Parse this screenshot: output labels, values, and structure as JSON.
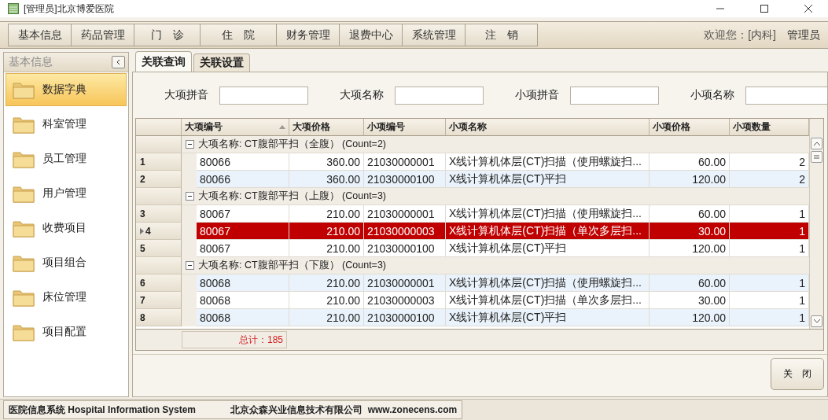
{
  "window": {
    "title": "[管理员]北京博爱医院"
  },
  "menu": [
    "基本信息",
    "药品管理",
    "门　诊",
    "住　院",
    "财务管理",
    "退费中心",
    "系统管理",
    "注　销"
  ],
  "user": {
    "welcome": "欢迎您：[内科]",
    "name": "管理员"
  },
  "sidebar": {
    "title": "基本信息",
    "items": [
      {
        "label": "数据字典",
        "selected": true
      },
      {
        "label": "科室管理",
        "selected": false
      },
      {
        "label": "员工管理",
        "selected": false
      },
      {
        "label": "用户管理",
        "selected": false
      },
      {
        "label": "收费项目",
        "selected": false
      },
      {
        "label": "项目组合",
        "selected": false
      },
      {
        "label": "床位管理",
        "selected": false
      },
      {
        "label": "项目配置",
        "selected": false
      }
    ]
  },
  "tabs": [
    {
      "label": "关联查询",
      "selected": true
    },
    {
      "label": "关联设置",
      "selected": false
    }
  ],
  "filters": [
    {
      "label": "大项拼音"
    },
    {
      "label": "大项名称"
    },
    {
      "label": "小项拼音"
    },
    {
      "label": "小项名称"
    }
  ],
  "table": {
    "columns": [
      "大项编号",
      "大项价格",
      "小项编号",
      "小项名称",
      "小项价格",
      "小项数量"
    ],
    "rows": [
      {
        "kind": "group",
        "label": "大项名称: CT腹部平扫（全腹） (Count=2)",
        "expanded": true
      },
      {
        "kind": "item",
        "number": "1",
        "selected": false,
        "cells": [
          "80066",
          "360.00",
          "21030000001",
          "X线计算机体层(CT)扫描（使用螺旋扫...",
          "60.00",
          "2"
        ]
      },
      {
        "kind": "item",
        "number": "2",
        "selected": false,
        "cells": [
          "80066",
          "360.00",
          "21030000100",
          "X线计算机体层(CT)平扫",
          "120.00",
          "2"
        ]
      },
      {
        "kind": "group",
        "label": "大项名称: CT腹部平扫（上腹） (Count=3)",
        "expanded": true
      },
      {
        "kind": "item",
        "number": "3",
        "selected": false,
        "cells": [
          "80067",
          "210.00",
          "21030000001",
          "X线计算机体层(CT)扫描（使用螺旋扫...",
          "60.00",
          "1"
        ]
      },
      {
        "kind": "item",
        "number": "4",
        "selected": true,
        "cells": [
          "80067",
          "210.00",
          "21030000003",
          "X线计算机体层(CT)扫描（单次多层扫...",
          "30.00",
          "1"
        ]
      },
      {
        "kind": "item",
        "number": "5",
        "selected": false,
        "cells": [
          "80067",
          "210.00",
          "21030000100",
          "X线计算机体层(CT)平扫",
          "120.00",
          "1"
        ]
      },
      {
        "kind": "group",
        "label": "大项名称: CT腹部平扫（下腹） (Count=3)",
        "expanded": true
      },
      {
        "kind": "item",
        "number": "6",
        "selected": false,
        "cells": [
          "80068",
          "210.00",
          "21030000001",
          "X线计算机体层(CT)扫描（使用螺旋扫...",
          "60.00",
          "1"
        ]
      },
      {
        "kind": "item",
        "number": "7",
        "selected": false,
        "cells": [
          "80068",
          "210.00",
          "21030000003",
          "X线计算机体层(CT)扫描（单次多层扫...",
          "30.00",
          "1"
        ]
      },
      {
        "kind": "item",
        "number": "8",
        "selected": false,
        "cells": [
          "80068",
          "210.00",
          "21030000100",
          "X线计算机体层(CT)平扫",
          "120.00",
          "1"
        ]
      }
    ],
    "total": "总计：185"
  },
  "close_button": "关　闭",
  "status_bar": {
    "system": "医院信息系统 Hospital Information System",
    "company": "北京众森兴业信息技术有限公司  www.zonecens.com"
  }
}
